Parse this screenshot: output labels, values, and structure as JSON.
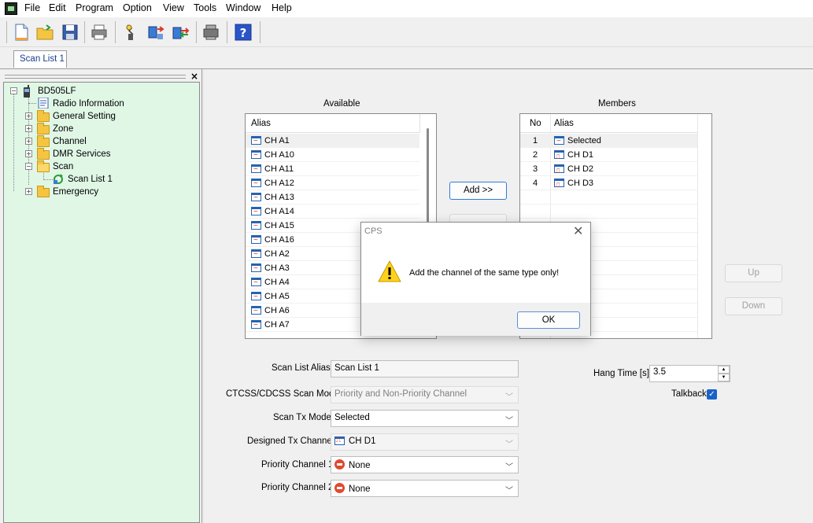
{
  "menu": {
    "items": [
      "File",
      "Edit",
      "Program",
      "Option",
      "View",
      "Tools",
      "Window",
      "Help"
    ]
  },
  "toolbar": {
    "icons": [
      "new-icon",
      "open-icon",
      "save-icon",
      "print-icon",
      "read-radio-icon",
      "write-radio-icon",
      "transfer-icon",
      "program-icon",
      "help-icon"
    ]
  },
  "tab": {
    "label": "Scan List 1"
  },
  "tree": {
    "root": "BD505LF",
    "radio_info": "Radio Information",
    "general": "General Setting",
    "zone": "Zone",
    "channel": "Channel",
    "dmr": "DMR Services",
    "scan": "Scan",
    "scan_list": "Scan List 1",
    "emergency": "Emergency"
  },
  "available": {
    "title": "Available",
    "header": "Alias",
    "rows": [
      "CH A1",
      "CH A10",
      "CH A11",
      "CH A12",
      "CH A13",
      "CH A14",
      "CH A15",
      "CH A16",
      "CH A2",
      "CH A3",
      "CH A4",
      "CH A5",
      "CH A6",
      "CH A7"
    ]
  },
  "members": {
    "title": "Members",
    "header_no": "No",
    "header_alias": "Alias",
    "rows": [
      {
        "no": "1",
        "alias": "Selected"
      },
      {
        "no": "2",
        "alias": "CH D1"
      },
      {
        "no": "3",
        "alias": "CH D2"
      },
      {
        "no": "4",
        "alias": "CH D3"
      }
    ]
  },
  "buttons": {
    "add": "Add >>",
    "up": "Up",
    "down": "Down"
  },
  "form": {
    "scan_list_alias_label": "Scan List Alias",
    "scan_list_alias_value": "Scan List 1",
    "ctcss_label": "CTCSS/CDCSS Scan Mode",
    "ctcss_value": "Priority and Non-Priority Channel",
    "scan_tx_label": "Scan Tx Mode",
    "scan_tx_value": "Selected",
    "designed_tx_label": "Designed Tx Channel",
    "designed_tx_value": "CH D1",
    "priority1_label": "Priority Channel 1",
    "priority1_value": "None",
    "priority2_label": "Priority Channel 2",
    "priority2_value": "None",
    "hang_time_label": "Hang Time [s]",
    "hang_time_value": "3.5",
    "talkback_label": "Talkback",
    "talkback_checked": true
  },
  "dialog": {
    "title": "CPS",
    "message": "Add the channel of the same type only!",
    "ok": "OK"
  }
}
